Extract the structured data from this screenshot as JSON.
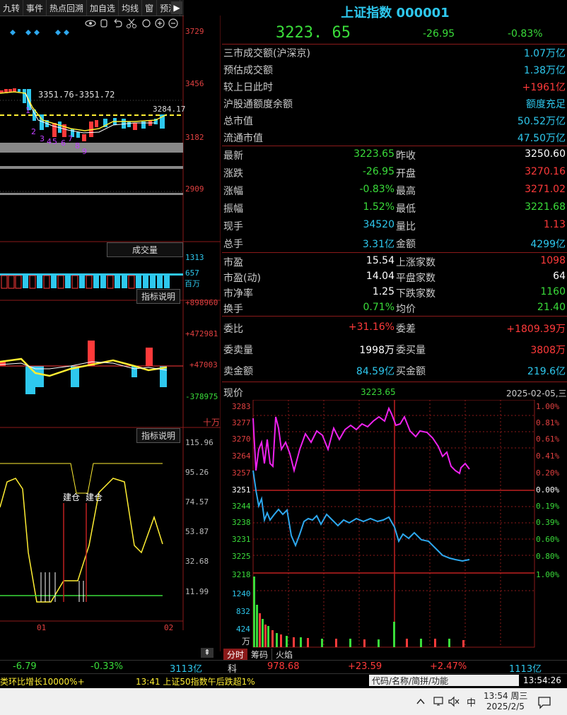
{
  "toolbar": {
    "items": [
      "九转",
      "事件",
      "热点回溯",
      "加自选",
      "均线",
      "窗",
      "预测"
    ],
    "icon_tools": [
      "eye-icon",
      "hand-icon",
      "undo-icon",
      "scissors-icon",
      "refresh-icon",
      "zoom-in-icon",
      "zoom-out-icon"
    ]
  },
  "kline": {
    "price_ticks": [
      "3729",
      "3456",
      "3182",
      "2909"
    ],
    "range_label": "3351.76-3351.72",
    "current_line_label": "3284.17",
    "seq_marks": [
      "1",
      "2",
      "3",
      "4",
      "5",
      "6",
      "7",
      "8",
      "9"
    ],
    "volume_button": "成交量",
    "volume_ticks": [
      "1313",
      "657"
    ],
    "volume_unit": "百万",
    "macd_button": "指标说明",
    "macd_ticks": [
      "+898960",
      "+472981",
      "+47003",
      "-378975"
    ],
    "macd_unit": "十万",
    "kdj_button": "指标说明",
    "kdj_ticks": [
      "115.96",
      "95.26",
      "74.57",
      "53.87",
      "32.68",
      "11.99"
    ],
    "kdj_labels": [
      "建仓",
      "建仓"
    ],
    "date_ticks": [
      "01",
      "02"
    ]
  },
  "quote": {
    "title": "上证指数  000001",
    "price": "3223. 65",
    "change": "-26.95",
    "change_pct": "-0.83%",
    "info_rows": [
      {
        "label": "三市成交额(沪深京)",
        "value": "1.07万亿",
        "color": "#2ec8ee"
      },
      {
        "label": "预估成交额",
        "value": "1.38万亿",
        "color": "#2ec8ee"
      },
      {
        "label": "较上日此时",
        "value": "+1961亿",
        "color": "#ff3a3a"
      },
      {
        "label": "沪股通额度余额",
        "value": "额度充足",
        "color": "#2ec8ee"
      },
      {
        "label": "总市值",
        "value": "50.52万亿",
        "color": "#2ec8ee"
      },
      {
        "label": "流通市值",
        "value": "47.50万亿",
        "color": "#2ec8ee"
      }
    ],
    "grid_rows": [
      {
        "l1": "最新",
        "v1": "3223.65",
        "c1": "#3adc3a",
        "l2": "昨收",
        "v2": "3250.60",
        "c2": "#ffffff"
      },
      {
        "l1": "涨跌",
        "v1": "-26.95",
        "c1": "#3adc3a",
        "l2": "开盘",
        "v2": "3270.16",
        "c2": "#ff3a3a"
      },
      {
        "l1": "涨幅",
        "v1": "-0.83%",
        "c1": "#3adc3a",
        "l2": "最高",
        "v2": "3271.02",
        "c2": "#ff3a3a"
      },
      {
        "l1": "振幅",
        "v1": "1.52%",
        "c1": "#3adc3a",
        "l2": "最低",
        "v2": "3221.68",
        "c2": "#3adc3a"
      },
      {
        "l1": "现手",
        "v1": "34520",
        "c1": "#2ec8ee",
        "l2": "量比",
        "v2": "1.13",
        "c2": "#ff3a3a"
      },
      {
        "l1": "总手",
        "v1": "3.31亿",
        "c1": "#2ec8ee",
        "l2": "金额",
        "v2": "4299亿",
        "c2": "#2ec8ee"
      }
    ],
    "stat_rows": [
      {
        "l1": "市盈",
        "v1": "15.54",
        "c1": "#ffffff",
        "l2": "上涨家数",
        "v2": "1098",
        "c2": "#ff3a3a"
      },
      {
        "l1": "市盈(动)",
        "v1": "14.04",
        "c1": "#ffffff",
        "l2": "平盘家数",
        "v2": "64",
        "c2": "#ffffff"
      },
      {
        "l1": "市净率",
        "v1": "1.25",
        "c1": "#ffffff",
        "l2": "下跌家数",
        "v2": "1160",
        "c2": "#3adc3a"
      },
      {
        "l1": "换手",
        "v1": "0.71%",
        "c1": "#3adc3a",
        "l2": "均价",
        "v2": "21.40",
        "c2": "#3adc3a"
      }
    ],
    "order_rows": [
      {
        "l1": "委比",
        "v1": "+31.16%",
        "c1": "#ff3a3a",
        "l2": "委差",
        "v2": "+1809.39万",
        "c2": "#ff3a3a"
      },
      {
        "l1": "委卖量",
        "v1": "1998万",
        "c1": "#ffffff",
        "l2": "委买量",
        "v2": "3808万",
        "c2": "#ff3a3a"
      },
      {
        "l1": "卖金额",
        "v1": "84.59亿",
        "c1": "#2ec8ee",
        "l2": "买金额",
        "v2": "219.6亿",
        "c2": "#2ec8ee"
      }
    ]
  },
  "intraday": {
    "label": "现价",
    "price": "3223.65",
    "date": "2025-02-05,三",
    "price_ticks": [
      "3283",
      "3277",
      "3270",
      "3264",
      "3257",
      "3251",
      "3244",
      "3238",
      "3231",
      "3225",
      "3218"
    ],
    "pct_ticks": [
      "1.00%",
      "0.81%",
      "0.61%",
      "0.41%",
      "0.20%",
      "0.00%",
      "0.19%",
      "0.39%",
      "0.60%",
      "0.80%",
      "1.00%"
    ],
    "vol_ticks": [
      "1240",
      "832",
      "424"
    ],
    "vol_unit": "万",
    "tabs": [
      "分时",
      "筹码",
      "火焰"
    ]
  },
  "ticker": {
    "left_change": "-6.79",
    "left_pct": "-0.33%",
    "left_amount": "3113亿",
    "right_name": "科",
    "right_price": "978.68",
    "right_change": "+23.59",
    "right_pct": "+2.47%",
    "right_amount": "1113亿"
  },
  "news_bar": {
    "msg1": "类环比增长10000%+",
    "msg2": "13:41 上证50指数午后跌超1%",
    "search_placeholder": "代码/名称/简拼/功能",
    "time": "13:54:26"
  },
  "taskbar": {
    "ime": "中",
    "time": "13:54 周三",
    "date": "2025/2/5"
  }
}
